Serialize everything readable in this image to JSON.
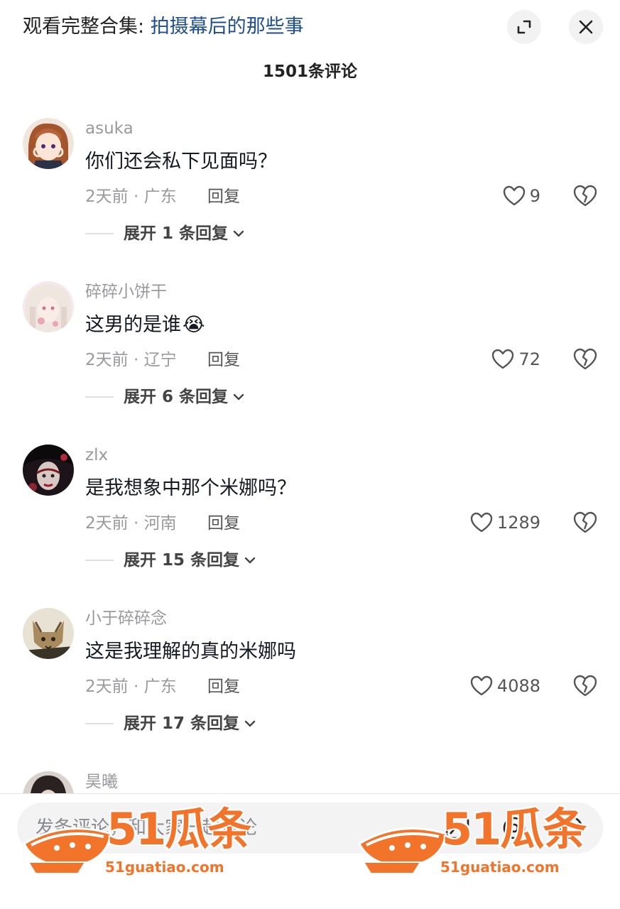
{
  "header": {
    "collection_prefix": "观看完整合集: ",
    "collection_link": "拍摄幕后的那些事",
    "expand_icon": "expand-icon",
    "close_icon": "close-icon"
  },
  "comment_count": "1501条评论",
  "comments": [
    {
      "username": "asuka",
      "text": "你们还会私下见面吗？",
      "emoji": "",
      "meta": "2天前 · 广东",
      "reply_label": "回复",
      "likes": "9",
      "expand": "展开 1 条回复"
    },
    {
      "username": "碎碎小饼干",
      "text": "这男的是谁",
      "emoji": "😭",
      "meta": "2天前 · 辽宁",
      "reply_label": "回复",
      "likes": "72",
      "expand": "展开 6 条回复"
    },
    {
      "username": "zlx",
      "text": "是我想象中那个米娜吗？",
      "emoji": "",
      "meta": "2天前 · 河南",
      "reply_label": "回复",
      "likes": "1289",
      "expand": "展开 15 条回复"
    },
    {
      "username": "小于碎碎念",
      "text": "这是我理解的真的米娜吗",
      "emoji": "",
      "meta": "2天前 · 广东",
      "reply_label": "回复",
      "likes": "4088",
      "expand": "展开 17 条回复"
    },
    {
      "username": "昊曦"
    }
  ],
  "input": {
    "placeholder": "发条评论，和大家一起讨论"
  },
  "watermark": {
    "text": "51瓜条",
    "url": "51guatiao.com"
  },
  "colors": {
    "link": "#1e4f8c",
    "watermark": "#f2742a",
    "muted": "#9a9a9e"
  }
}
